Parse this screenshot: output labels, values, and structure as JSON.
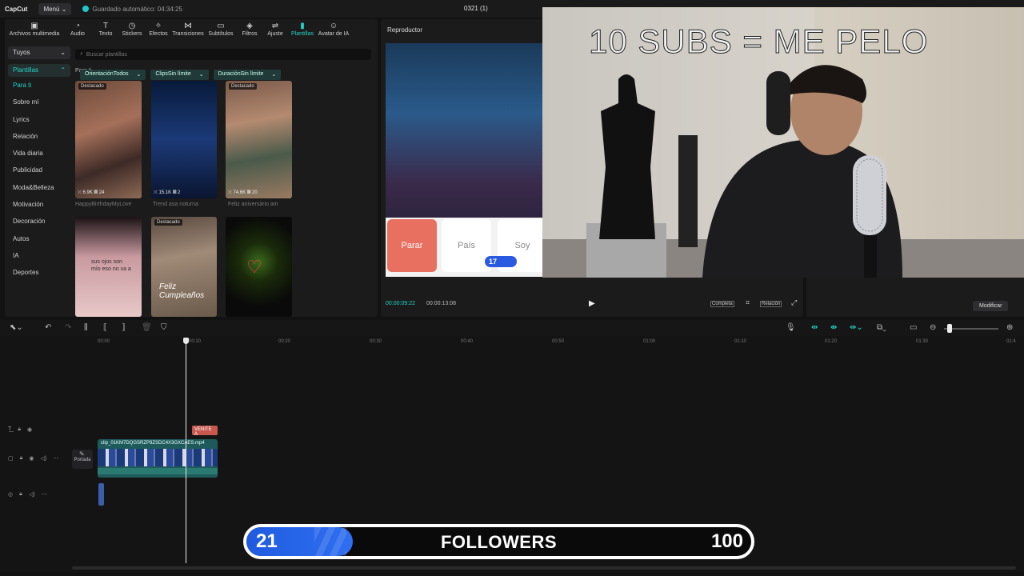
{
  "app": {
    "logo": "CapCut",
    "menu_label": "Menú",
    "autosave": "Guardado automático: 04:34:25",
    "project_title": "0321 (1)"
  },
  "toolbar": {
    "items": [
      {
        "label": "Archivos multimedia",
        "icon": "media-icon"
      },
      {
        "label": "Audio",
        "icon": "audio-icon"
      },
      {
        "label": "Texto",
        "icon": "text-icon"
      },
      {
        "label": "Stickers",
        "icon": "sticker-icon"
      },
      {
        "label": "Efectos",
        "icon": "effects-icon"
      },
      {
        "label": "Transiciones",
        "icon": "transition-icon"
      },
      {
        "label": "Subtítulos",
        "icon": "subtitles-icon"
      },
      {
        "label": "Filtros",
        "icon": "filters-icon"
      },
      {
        "label": "Ajuste",
        "icon": "adjust-icon"
      },
      {
        "label": "Plantillas",
        "icon": "templates-icon"
      },
      {
        "label": "Avatar de IA",
        "icon": "ai-avatar-icon"
      }
    ]
  },
  "sidebar": {
    "dropdown": "Tuyos",
    "group": "Plantillas",
    "items": [
      "Para ti",
      "Sobre mí",
      "Lyrics",
      "Relación",
      "Vida diaria",
      "Publicidad",
      "Moda&Belleza",
      "Motivación",
      "Decoración",
      "Autos",
      "IA",
      "Deportes"
    ]
  },
  "search": {
    "placeholder": "Buscar plantillas"
  },
  "section_label": "Para ti",
  "filters": [
    {
      "label": "Orientación",
      "value": "Todos"
    },
    {
      "label": "Clips",
      "value": "Sin límite"
    },
    {
      "label": "Duración",
      "value": "Sin límite"
    }
  ],
  "cards": [
    {
      "badge": "Destacado",
      "stats": "⤫ 6.9K  ▦ 24",
      "caption": "HappyBirthdayMyLove"
    },
    {
      "badge": "",
      "stats": "⤫ 15.1K  ▦ 2",
      "caption": "Trend asa noturna"
    },
    {
      "badge": "Destacado",
      "stats": "⤫ 74.6K  ▦ 20",
      "caption": "Feliz aniversário am"
    },
    {
      "badge": "",
      "overlay": "sus ojos son mío eso no va a",
      "caption": ""
    },
    {
      "badge": "Destacado",
      "overlay": "Feliz Cumpleaños",
      "caption": ""
    },
    {
      "badge": "",
      "caption": ""
    }
  ],
  "player": {
    "title": "Reproductor",
    "current": "00:00:09:22",
    "total": "00:00:13:08",
    "btn_full": "Completa",
    "btn_ratio": "Relación",
    "stream_buttons": [
      "Parar",
      "País",
      "Soy"
    ],
    "stream_counter": "17"
  },
  "modify_label": "Modificar",
  "webcam_text": "10 SUBS = ME PELO",
  "timeline": {
    "ticks": [
      "00:00",
      "00:10",
      "00:20",
      "00:30",
      "00:40",
      "00:50",
      "01:00",
      "01:10",
      "01:20",
      "01:30",
      "01:4"
    ],
    "clip_name": "clip_01KM7DQGSRZP9ZSDC4X3GXCAES.mp4",
    "text_clip": "VENITE A",
    "portada": "Portada"
  },
  "followers": {
    "current": "21",
    "label": "FOLLOWERS",
    "goal": "100",
    "progress": 0.21
  },
  "colors": {
    "accent": "#22d3c5",
    "bar": "#2f6ff0",
    "text_clip": "#c8584e"
  }
}
